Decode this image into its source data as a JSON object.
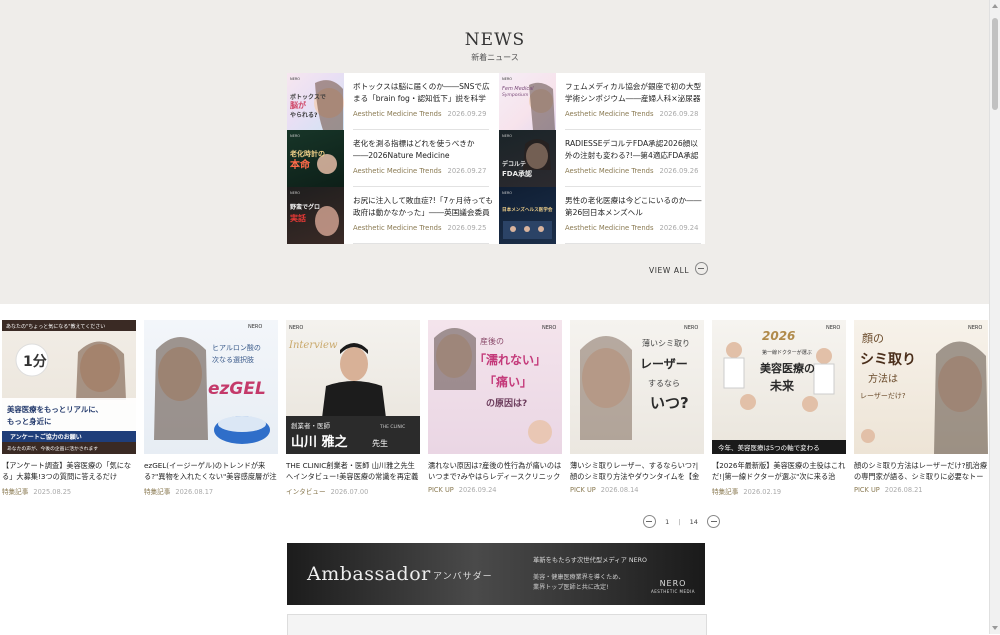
{
  "news": {
    "title": "NEWS",
    "subtitle": "新着ニュース",
    "items": [
      {
        "headline": "ボトックスは脳に届くのか――SNSで広まる「brain fog・認知低下」説を科学で読む",
        "category": "Aesthetic Medicine Trends",
        "date": "2026.09.29"
      },
      {
        "headline": "フェムメディカル協会が銀座で初の大型学術シンポジウム――産婦人科×泌尿器科が…",
        "category": "Aesthetic Medicine Trends",
        "date": "2026.09.28"
      },
      {
        "headline": "老化を測る指標はどれを使うべきか――2026Nature Medicine",
        "category": "Aesthetic Medicine Trends",
        "date": "2026.09.27"
      },
      {
        "headline": "RADIESSEデコルテFDA承認2026顔以外の注射も変わる?!―第4適応FDA承認バイ…",
        "category": "Aesthetic Medicine Trends",
        "date": "2026.09.26"
      },
      {
        "headline": "お尻に注入して敗血症?!「7ヶ月待っても政府は動かなかった」――英国議会委員会…",
        "category": "Aesthetic Medicine Trends",
        "date": "2026.09.25"
      },
      {
        "headline": "男性の老化医療は今どこにいるのか――第26回日本メンズヘル",
        "category": "Aesthetic Medicine Trends",
        "date": "2026.09.24"
      }
    ],
    "view_all": "VIEW ALL"
  },
  "cards": [
    {
      "title": "【アンケート調査】美容医療の「気になる」大募集!3つの質問に答えるだけ",
      "category": "特集記事",
      "date": "2025.08.25"
    },
    {
      "title": "ezGEL(イージーゲル)のトレンドが来る?\"異物を入れたくない\"美容感度層が注目…",
      "category": "特集記事",
      "date": "2026.08.17"
    },
    {
      "title": "THE CLINIC創業者・医師 山川雅之先生へインタビュー!美容医療の常識を再定義す…",
      "category": "インタビュー",
      "date": "2026.07.00"
    },
    {
      "title": "濡れない原因は?産後の性行為が痛いのはいつまで?みやはらレディースクリニックの…",
      "category": "PICK UP",
      "date": "2026.09.24"
    },
    {
      "title": "薄いシミ取りレーザー、するならいつ?|顔のシミ取り方法やダウンタイムを【金沢・野々…",
      "category": "PICK UP",
      "date": "2026.08.14"
    },
    {
      "title": "【2026年最新版】美容医療の主役はこれだ!|第一線ドクターが選ぶ\"次に来る治療\"…",
      "category": "特集記事",
      "date": "2026.02.19"
    },
    {
      "title": "顔のシミ取り方法はレーザーだけ?肌治療の専門家が語る、シミ取りに必要なトータ…",
      "category": "PICK UP",
      "date": "2026.08.21"
    }
  ],
  "pagination": {
    "current": "1",
    "total": "14"
  },
  "banner": {
    "title": "Ambassador",
    "title_jp": "アンバサダー",
    "tagline": "革新をもたらす次世代型メディア NERO",
    "desc_line1": "美容・健康医療業界を導くため、",
    "desc_line2": "業界トップ医師と共に改定!",
    "logo": "NERO",
    "logo_sub": "AESTHETIC MEDIA"
  },
  "graphics": {
    "news_thumb_1": [
      "ボトックスで",
      "脳が",
      "やられる?"
    ],
    "news_thumb_2": [
      "Fem Medical",
      "Symposium"
    ],
    "news_thumb_3": [
      "老化時計の",
      "本命"
    ],
    "news_thumb_4": [
      "デコルテ",
      "FDA承認"
    ],
    "news_thumb_5": [
      "野蛮でグロ",
      "実話"
    ],
    "news_thumb_6": [
      "日本メンズヘルス医学会"
    ],
    "card_1": {
      "top": "あなたの\"ちょっと気になる\"教えてください",
      "time": "1分",
      "main1": "美容医療をもっとリアルに、",
      "main2": "もっと身近に",
      "ribbon": "アンケートご協力のお願い",
      "bottom": "あなたの声が、今後の企画に活かされます"
    },
    "card_2": {
      "line1": "ヒアルロン酸の",
      "line2": "次なる選択肢",
      "brand": "ezGEL"
    },
    "card_3": {
      "script": "Interview",
      "role": "創業者・医師",
      "name": "山川 雅之",
      "suffix": "先生",
      "clinic": "THE CLINIC"
    },
    "card_4": {
      "l1": "産後の",
      "l2": "「濡れない」",
      "l3": "「痛い」",
      "l4": "の原因は?"
    },
    "card_5": {
      "l1": "薄いシミ取り",
      "l2": "レーザー",
      "l3": "するなら",
      "l4": "いつ?"
    },
    "card_6": {
      "year": "2026",
      "l1": "第一線ドクターが選ぶ",
      "l2": "美容医療の",
      "l3": "未来",
      "l4": "今年、美容医療は5つの軸で変わる"
    },
    "card_7": {
      "l1": "顔の",
      "l2": "シミ取り",
      "l3": "方法は",
      "l4": "レーザーだけ?"
    }
  },
  "colors": {
    "news_bg": "#efedea",
    "accent_gold": "#8a7a52",
    "banner_bg": "#2a2a2a"
  }
}
